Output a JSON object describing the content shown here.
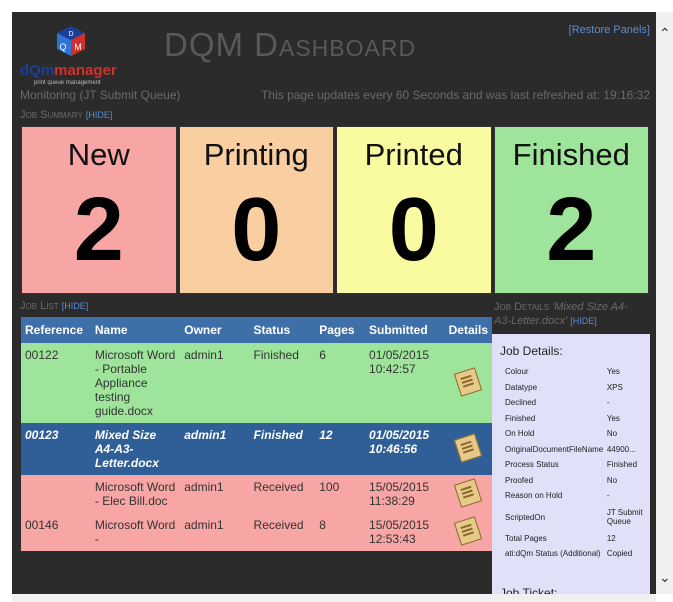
{
  "app": {
    "title": "DQM Dashboard",
    "restore": "[Restore Panels]",
    "logo_dqm": "dQm",
    "logo_manager": "manager",
    "logo_tag": "print queue management",
    "logo_cube_letters": [
      "D",
      "Q",
      "M"
    ]
  },
  "status": {
    "monitoring": "Monitoring (JT Submit Queue)",
    "refresh": "This page updates every 60 Seconds and was last refreshed at: 19:16:32"
  },
  "summary": {
    "label": "Job Summary",
    "hide": "[HIDE]",
    "tiles": [
      {
        "label": "New",
        "count": "2",
        "color": "#f7a5a5"
      },
      {
        "label": "Printing",
        "count": "0",
        "color": "#f9cfa2"
      },
      {
        "label": "Printed",
        "count": "0",
        "color": "#fafaa0"
      },
      {
        "label": "Finished",
        "count": "2",
        "color": "#9fe49b"
      }
    ]
  },
  "joblist": {
    "label": "Job List",
    "hide": "[HIDE]",
    "columns": [
      "Reference",
      "Name",
      "Owner",
      "Status",
      "Pages",
      "Submitted",
      "Details"
    ],
    "rows": [
      {
        "ref": "00122",
        "name": "Microsoft Word - Portable Appliance testing guide.docx",
        "owner": "admin1",
        "status": "Finished",
        "pages": "6",
        "submitted": "01/05/2015 10:42:57",
        "style": "green"
      },
      {
        "ref": "00123",
        "name": "Mixed Size A4-A3-Letter.docx",
        "owner": "admin1",
        "status": "Finished",
        "pages": "12",
        "submitted": "01/05/2015 10:46:56",
        "style": "sel"
      },
      {
        "ref": "",
        "name": "Microsoft Word - Elec Bill.doc",
        "owner": "admin1",
        "status": "Received",
        "pages": "100",
        "submitted": "15/05/2015 11:38:29",
        "style": "pink"
      },
      {
        "ref": "00146",
        "name": "Microsoft Word -",
        "owner": "admin1",
        "status": "Received",
        "pages": "8",
        "submitted": "15/05/2015 12:53:43",
        "style": "pink"
      }
    ]
  },
  "details": {
    "label": "Job Details",
    "doc_line1": "'Mixed Size A4-",
    "doc_line2": "A3-Letter.docx'",
    "hide": "[HIDE]",
    "heading": "Job Details:",
    "rows": [
      {
        "k": "Colour",
        "v": "Yes"
      },
      {
        "k": "Datatype",
        "v": "XPS"
      },
      {
        "k": "Declined",
        "v": "-"
      },
      {
        "k": "Finished",
        "v": "Yes"
      },
      {
        "k": "On Hold",
        "v": "No"
      },
      {
        "k": "OriginalDocumentFileName",
        "v": "44900..."
      },
      {
        "k": "Process Status",
        "v": "Finished"
      },
      {
        "k": "Proofed",
        "v": "No"
      },
      {
        "k": "Reason on Hold",
        "v": "-"
      },
      {
        "k": "ScriptedOn",
        "v": "JT Submit Queue"
      },
      {
        "k": "Total Pages",
        "v": "12"
      },
      {
        "k": "ati:dQm Status (Additional)",
        "v": "Copied"
      }
    ],
    "ticket": "Job Ticket:"
  }
}
